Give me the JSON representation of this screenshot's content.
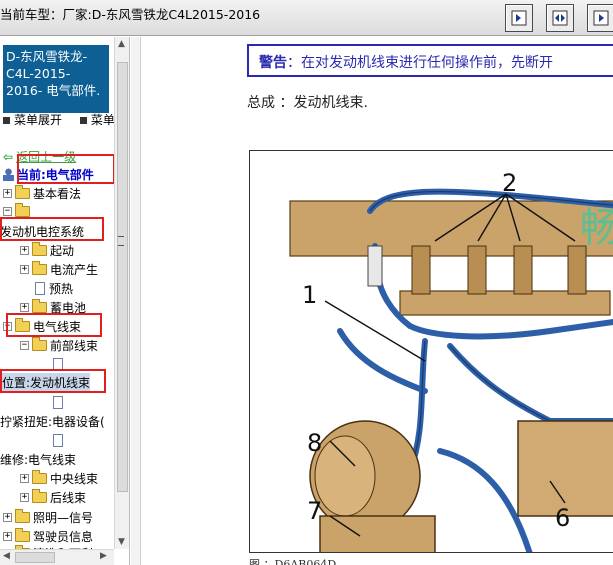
{
  "header": {
    "title": "当前车型：厂家:D-东风雪铁龙C4L2015-2016"
  },
  "sidebar": {
    "car_lines": [
      "D-东风雪铁龙-",
      "C4L-2015-",
      "2016- 电气部件."
    ],
    "menu_expand": "菜单展开",
    "menu_collapse": "菜单",
    "back": "返回上一级",
    "current": "当前:电气部件",
    "items": [
      {
        "label": "基本看法"
      },
      {
        "label": ""
      },
      {
        "label": "发动机电控系统"
      },
      {
        "label": "起动"
      },
      {
        "label": "电流产生"
      },
      {
        "label": "预热"
      },
      {
        "label": "蓄电池"
      },
      {
        "label": "电气线束"
      },
      {
        "label": "前部线束"
      },
      {
        "label": ""
      },
      {
        "label": "位置:发动机线束"
      },
      {
        "label": ""
      },
      {
        "label": "拧紧扭矩:电器设备("
      },
      {
        "label": ""
      },
      {
        "label": "维修:电气线束"
      },
      {
        "label": "中央线束"
      },
      {
        "label": "后线束"
      },
      {
        "label": "照明—信号"
      },
      {
        "label": "驾驶员信息"
      },
      {
        "label": "清洗和雨刮"
      }
    ]
  },
  "content": {
    "warning_label": "警告",
    "warning_text": "：在对发动机线束进行任何操作前，先断开",
    "assembly_text": "总成 ：发动机线束.",
    "figure_caption": "图 ：D6AB064D",
    "callouts": [
      "1",
      "2",
      "6",
      "7",
      "8"
    ],
    "watermark": "畅"
  },
  "colors": {
    "car_box": "#0d5f94",
    "warning_border": "#2a2ab0",
    "highlight_box": "#e02020",
    "harness_blue": "#2d5fa8",
    "component_tan": "#c9a36a"
  }
}
